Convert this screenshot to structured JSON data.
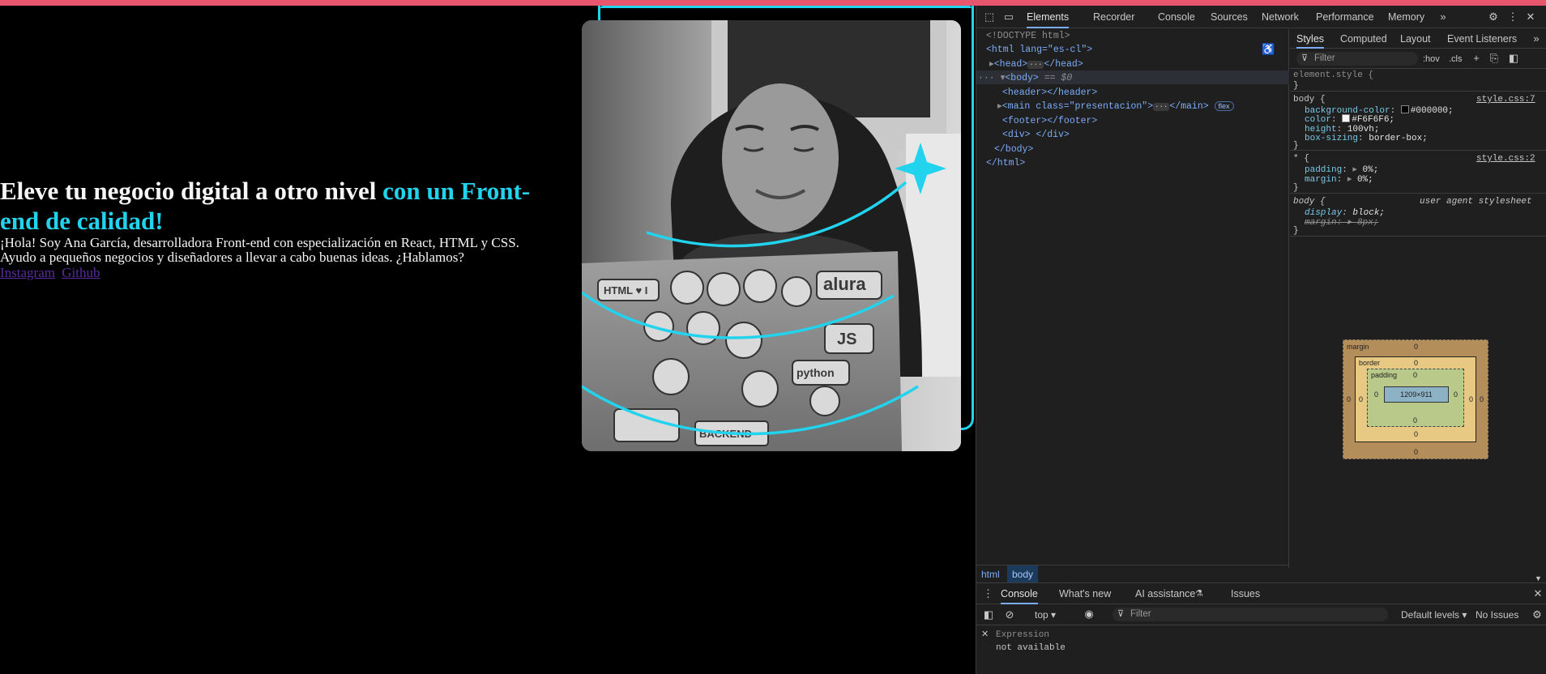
{
  "page": {
    "hero": {
      "title_main": "Eleve tu negocio digital a otro nivel ",
      "title_accent": "con un Front-end de calidad!",
      "text": "¡Hola! Soy Ana García, desarrolladora Front-end con especialización en React, HTML y CSS. Ayudo a pequeños negocios y diseñadores a llevar a cabo buenas ideas. ¿Hablamos?",
      "links": [
        "Instagram",
        "Github"
      ]
    },
    "photo": {
      "laptop_stickers": [
        "HTML ♥ I",
        "alura",
        "JS",
        "python",
        "BACKEND"
      ]
    }
  },
  "colors": {
    "background": "#000000",
    "text": "#F6F6F6",
    "accent": "#22d3ee",
    "topbar": "#e8566e",
    "link": "#5a2a9b"
  },
  "devtools": {
    "tabs": [
      "Elements",
      "Recorder",
      "Console",
      "Sources",
      "Network",
      "Performance",
      "Memory"
    ],
    "active_tab": "Elements",
    "dom": [
      "<!DOCTYPE html>",
      "<html lang=\"es-cl\">",
      "<head>",
      "</head>",
      "<body>",
      "== $0",
      "<header></header>",
      "<main class=\"presentacion\">",
      "</main>",
      "flex",
      "<footer></footer>",
      "<div> </div>",
      "</body>",
      "</html>"
    ],
    "breadcrumbs": [
      "html",
      "body"
    ],
    "styles_tabs": [
      "Styles",
      "Computed",
      "Layout",
      "Event Listeners"
    ],
    "filter_placeholder": "Filter",
    "toolbar": {
      "hov": ":hov",
      "cls": ".cls"
    },
    "rules": {
      "element_style": "element.style {",
      "body_selector": "body {",
      "body_source": "style.css:7",
      "body_props": [
        {
          "name": "background-color",
          "value": "#000000;"
        },
        {
          "name": "color",
          "value": "#F6F6F6;"
        },
        {
          "name": "height",
          "value": "100vh;"
        },
        {
          "name": "box-sizing",
          "value": "border-box;"
        }
      ],
      "star_selector": "* {",
      "star_source": "style.css:2",
      "star_props": [
        {
          "name": "padding",
          "value": "0%;"
        },
        {
          "name": "margin",
          "value": "0%;"
        }
      ],
      "ua_selector": "body {",
      "ua_source": "user agent stylesheet",
      "ua_props": [
        {
          "name": "display",
          "value": "block;"
        },
        {
          "name": "margin",
          "value": "8px;"
        }
      ],
      "close": "}"
    },
    "box_model": {
      "margin_label": "margin",
      "border_label": "border",
      "padding_label": "padding",
      "content": "1209×911",
      "zero": "0"
    },
    "console": {
      "tabs": [
        "Console",
        "What's new",
        "AI assistance",
        "Issues"
      ],
      "context": "top",
      "filter_placeholder": "Filter",
      "levels": "Default levels",
      "issues": "No Issues",
      "expression_placeholder": "Expression",
      "output": "not available"
    }
  }
}
